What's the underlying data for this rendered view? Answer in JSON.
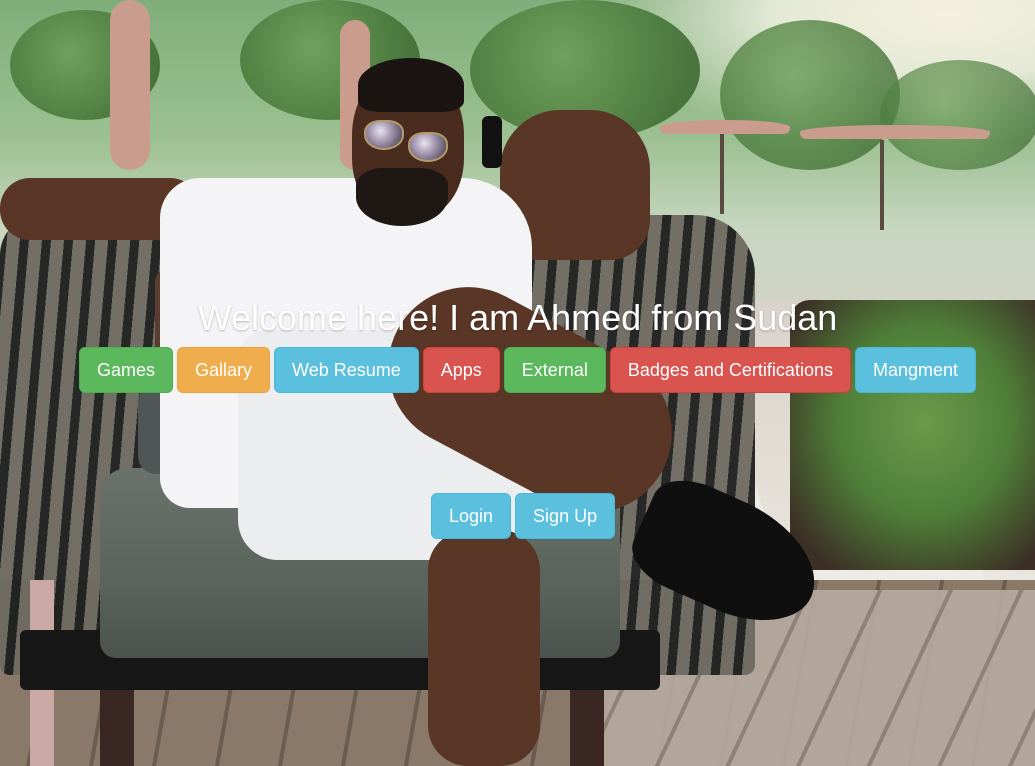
{
  "hero": {
    "heading": "Welcome here! I am Ahmed from Sudan",
    "background_photo": "man-in-white-outfit-on-chair-resort-photo"
  },
  "nav": {
    "buttons": [
      {
        "label": "Games",
        "style": "success",
        "color": "#5cb85c"
      },
      {
        "label": "Gallary",
        "style": "warning",
        "color": "#f0ad4e"
      },
      {
        "label": "Web Resume",
        "style": "info",
        "color": "#5bc0de"
      },
      {
        "label": "Apps",
        "style": "danger",
        "color": "#d9534f"
      },
      {
        "label": "External",
        "style": "success",
        "color": "#5cb85c"
      },
      {
        "label": "Badges and Certifications",
        "style": "danger",
        "color": "#d9534f"
      },
      {
        "label": "Mangment",
        "style": "info",
        "color": "#5bc0de"
      }
    ]
  },
  "auth": {
    "login_label": "Login",
    "signup_label": "Sign Up",
    "color": "#5bc0de"
  }
}
